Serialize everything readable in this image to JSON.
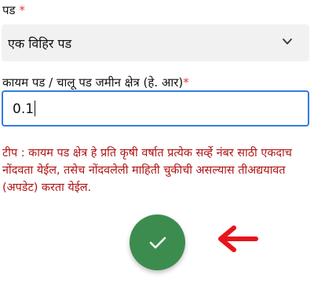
{
  "pad_field": {
    "label": "पड",
    "required_mark": "*",
    "selected_value": "एक विहिर पड"
  },
  "area_field": {
    "label": "कायम पड / चालू पड जमीन क्षेत्र (हे. आर)",
    "required_mark": "*",
    "value": "0.1"
  },
  "note": "टीप : कायम पड क्षेत्र हे प्रति कृषी वर्षात प्रत्येक सर्व्हे नंबर साठी एकदाच नोंदवता येईल, तसेच नोंदवलेली माहिती चुकीची असल्यास तीअद्ययावत (अपडेट) करता येईल.",
  "icons": {
    "dropdown": "chevron-down-icon",
    "submit": "checkmark-icon",
    "pointer": "red-arrow-icon"
  },
  "colors": {
    "required": "#e53935",
    "note_text": "#b01515",
    "input_border": "#2f7de1",
    "submit_button": "#3d8c4f",
    "arrow": "#e8141c"
  }
}
